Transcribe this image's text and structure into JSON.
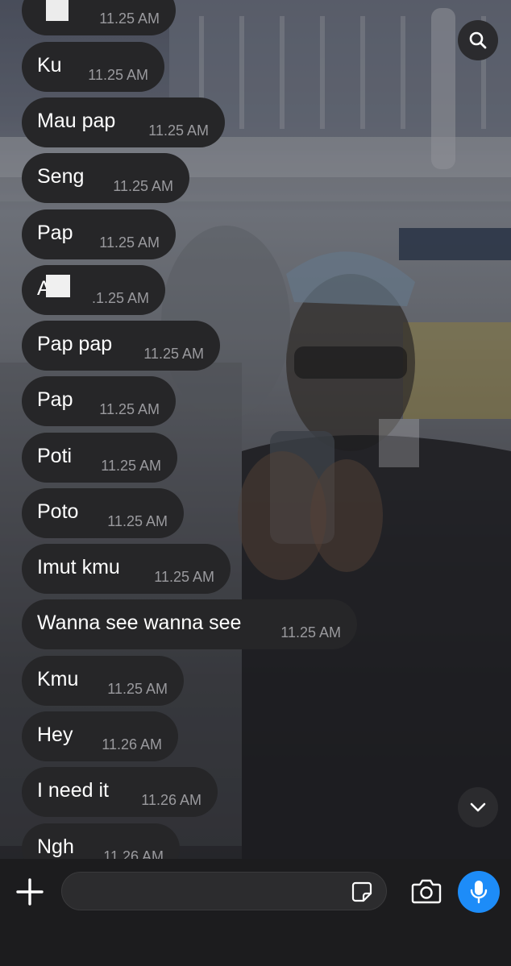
{
  "messages": [
    {
      "text": "",
      "time": "11.25 AM",
      "redacted": true
    },
    {
      "text": "Ku",
      "time": "11.25 AM"
    },
    {
      "text": "Mau pap",
      "time": "11.25 AM"
    },
    {
      "text": "Seng",
      "time": "11.25 AM"
    },
    {
      "text": "Pap",
      "time": "11.25 AM"
    },
    {
      "text": "A",
      "time": ".1.25 AM",
      "redacted": true
    },
    {
      "text": "Pap pap",
      "time": "11.25 AM"
    },
    {
      "text": "Pap",
      "time": "11.25 AM"
    },
    {
      "text": "Poti",
      "time": "11.25 AM"
    },
    {
      "text": "Poto",
      "time": "11.25 AM"
    },
    {
      "text": "Imut kmu",
      "time": "11.25 AM"
    },
    {
      "text": "Wanna see wanna see",
      "time": "11.25 AM"
    },
    {
      "text": "Kmu",
      "time": "11.25 AM"
    },
    {
      "text": "Hey",
      "time": "11.26 AM"
    },
    {
      "text": "I need it",
      "time": "11.26 AM"
    },
    {
      "text": "Ngh",
      "time": "11.26 AM"
    }
  ],
  "icons": {
    "search": "search-icon",
    "scroll_down": "chevron-down-icon",
    "add": "plus-icon",
    "sticker": "sticker-icon",
    "camera": "camera-icon",
    "mic": "microphone-icon"
  },
  "composer": {
    "input_value": "",
    "input_placeholder": ""
  },
  "colors": {
    "bubble": "#262628",
    "timestamp": "#9a9a9e",
    "mic_button": "#1d8cf8",
    "composer_bg": "#1c1c1e"
  }
}
